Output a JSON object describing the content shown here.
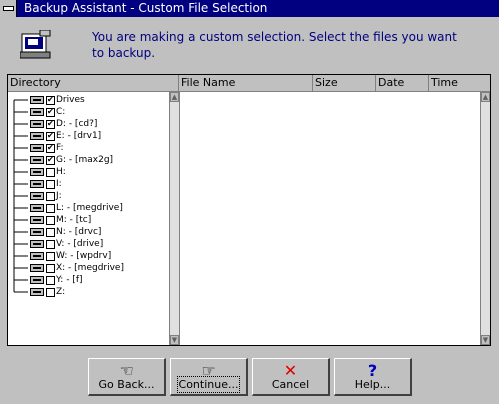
{
  "window": {
    "title": "Backup Assistant - Custom File Selection"
  },
  "intro": {
    "text": "You are making a custom selection. Select the files you want to backup."
  },
  "columns": [
    "Directory",
    "File Name",
    "Size",
    "Date",
    "Time"
  ],
  "tree": [
    {
      "label": "Drives",
      "checked": true
    },
    {
      "label": "C:",
      "checked": true
    },
    {
      "label": "D: - [cd?]",
      "checked": true
    },
    {
      "label": "E: - [drv1]",
      "checked": true
    },
    {
      "label": "F:",
      "checked": true
    },
    {
      "label": "G: - [max2g]",
      "checked": true
    },
    {
      "label": "H:",
      "checked": false
    },
    {
      "label": "I:",
      "checked": false
    },
    {
      "label": "J:",
      "checked": false
    },
    {
      "label": "L: - [megdrive]",
      "checked": false
    },
    {
      "label": "M: - [tc]",
      "checked": false
    },
    {
      "label": "N: - [drvc]",
      "checked": false
    },
    {
      "label": "V: - [drive]",
      "checked": false
    },
    {
      "label": "W: - [wpdrv]",
      "checked": false
    },
    {
      "label": "X: - [megdrive]",
      "checked": false
    },
    {
      "label": "Y: - [f]",
      "checked": false
    },
    {
      "label": "Z:",
      "checked": false
    }
  ],
  "buttons": {
    "back": "Go Back...",
    "continue": "Continue...",
    "cancel": "Cancel",
    "help": "Help..."
  },
  "icons": {
    "back": "hand-pointing-left-icon",
    "continue": "hand-pointing-right-icon",
    "cancel": "red-x-icon",
    "help": "question-mark-icon"
  },
  "colors": {
    "title_bar": "#000080",
    "intro_text": "#000080",
    "cancel_x": "#e00000",
    "help_q": "#0000c0"
  }
}
